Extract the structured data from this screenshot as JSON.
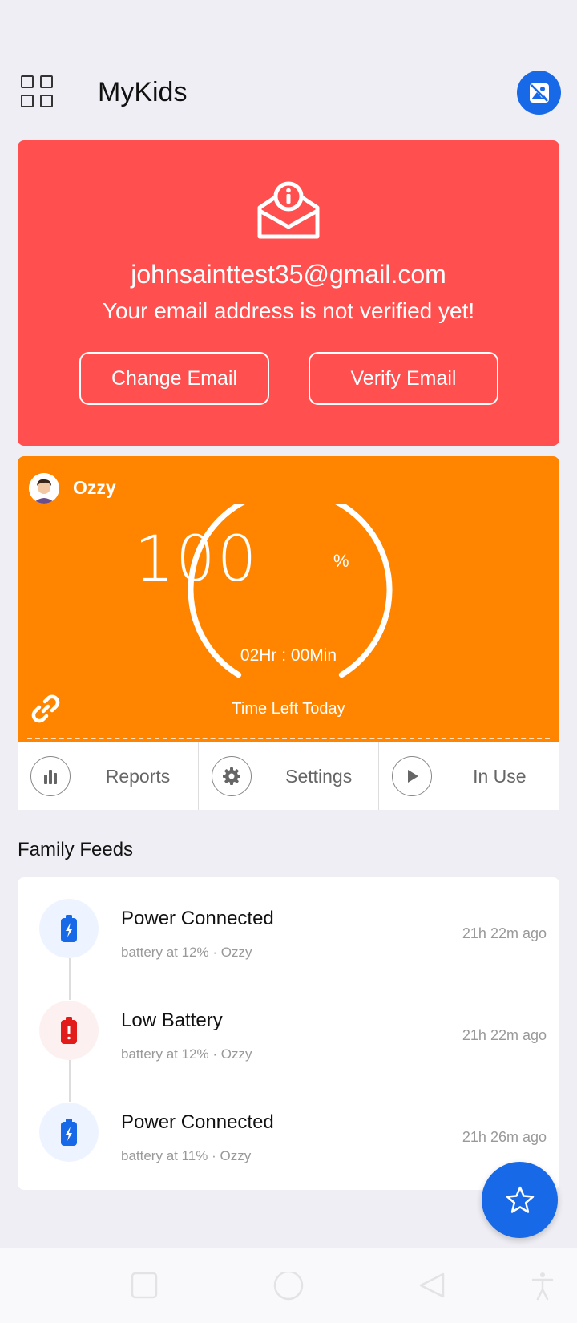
{
  "header": {
    "title": "MyKids",
    "menu_icon": "grid-icon",
    "profile_icon": "photo-icon"
  },
  "verify_card": {
    "email": "johnsainttest35@gmail.com",
    "message": "Your email address is not verified yet!",
    "change_label": "Change Email",
    "verify_label": "Verify Email",
    "icon": "mail-info-icon",
    "color": "#ff4f4f"
  },
  "kid": {
    "name": "Ozzy",
    "percent": "100",
    "percent_unit": "%",
    "time": "02Hr : 00Min",
    "time_label": "Time Left Today",
    "color": "#ff8500"
  },
  "actions": [
    {
      "label": "Reports",
      "icon": "bar-chart-icon"
    },
    {
      "label": "Settings",
      "icon": "gear-icon"
    },
    {
      "label": "In Use",
      "icon": "play-icon"
    }
  ],
  "feeds": {
    "title": "Family Feeds",
    "items": [
      {
        "title": "Power Connected",
        "subtitle": "battery at  12% · Ozzy",
        "time": "21h 22m ago",
        "icon": "battery-charging-icon"
      },
      {
        "title": "Low Battery",
        "subtitle": "battery at  12% · Ozzy",
        "time": "21h 22m ago",
        "icon": "battery-low-icon"
      },
      {
        "title": "Power Connected",
        "subtitle": "battery at  11% · Ozzy",
        "time": "21h 26m ago",
        "icon": "battery-charging-icon"
      }
    ]
  },
  "fab_icon": "star-icon",
  "accent": "#1769e8"
}
